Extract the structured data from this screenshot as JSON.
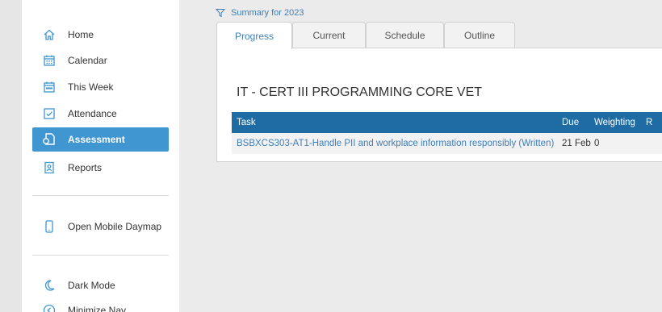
{
  "sidebar": {
    "items": [
      {
        "label": "Home",
        "icon": "home-icon"
      },
      {
        "label": "Calendar",
        "icon": "calendar-icon"
      },
      {
        "label": "This Week",
        "icon": "this-week-icon"
      },
      {
        "label": "Attendance",
        "icon": "attendance-icon"
      },
      {
        "label": "Assessment",
        "icon": "assessment-icon",
        "active": true
      },
      {
        "label": "Reports",
        "icon": "reports-icon"
      }
    ],
    "mobile": {
      "label": "Open Mobile Daymap",
      "icon": "mobile-icon"
    },
    "dark_mode": {
      "label": "Dark Mode",
      "icon": "moon-icon"
    },
    "minimize": {
      "label": "Minimize Nav",
      "icon": "minimize-icon"
    }
  },
  "summary": {
    "label": "Summary for 2023",
    "icon": "filter-icon"
  },
  "tabs": [
    {
      "label": "Progress",
      "active": true
    },
    {
      "label": "Current"
    },
    {
      "label": "Schedule"
    },
    {
      "label": "Outline"
    }
  ],
  "course": {
    "title": "IT - CERT III PROGRAMMING CORE VET"
  },
  "table": {
    "headers": {
      "task": "Task",
      "due": "Due",
      "weighting": "Weighting",
      "result": "R"
    },
    "rows": [
      {
        "task": "BSBXCS303-AT1-Handle PII and workplace information responsibly (Written)",
        "due": "21 Feb",
        "weighting": "0"
      }
    ]
  },
  "colors": {
    "accent": "#3f96d1",
    "header": "#1f6ca5",
    "link": "#3f7fb8"
  }
}
